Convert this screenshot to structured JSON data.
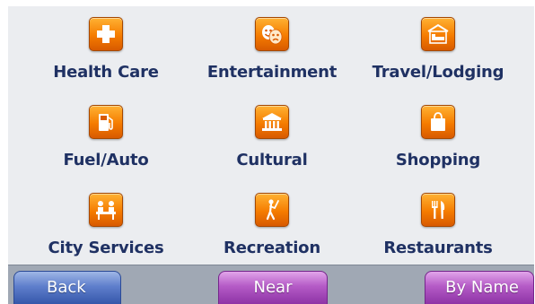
{
  "categories": [
    {
      "label": "Health Care",
      "icon": "cross-icon"
    },
    {
      "label": "Entertainment",
      "icon": "theater-masks-icon"
    },
    {
      "label": "Travel/Lodging",
      "icon": "bed-icon"
    },
    {
      "label": "Fuel/Auto",
      "icon": "fuel-pump-icon"
    },
    {
      "label": "Cultural",
      "icon": "museum-icon"
    },
    {
      "label": "Shopping",
      "icon": "shopping-bag-icon"
    },
    {
      "label": "City Services",
      "icon": "service-desk-icon"
    },
    {
      "label": "Recreation",
      "icon": "golfer-icon"
    },
    {
      "label": "Restaurants",
      "icon": "fork-knife-icon"
    }
  ],
  "footer": {
    "back_label": "Back",
    "near_label": "Near",
    "by_name_label": "By Name"
  },
  "colors": {
    "background": "#ebedf0",
    "label_text": "#1f3163",
    "icon_orange": "#f57c00",
    "back_button": "#4a6bbf",
    "near_button": "#b45ac6",
    "by_name_button": "#b45ac6"
  }
}
